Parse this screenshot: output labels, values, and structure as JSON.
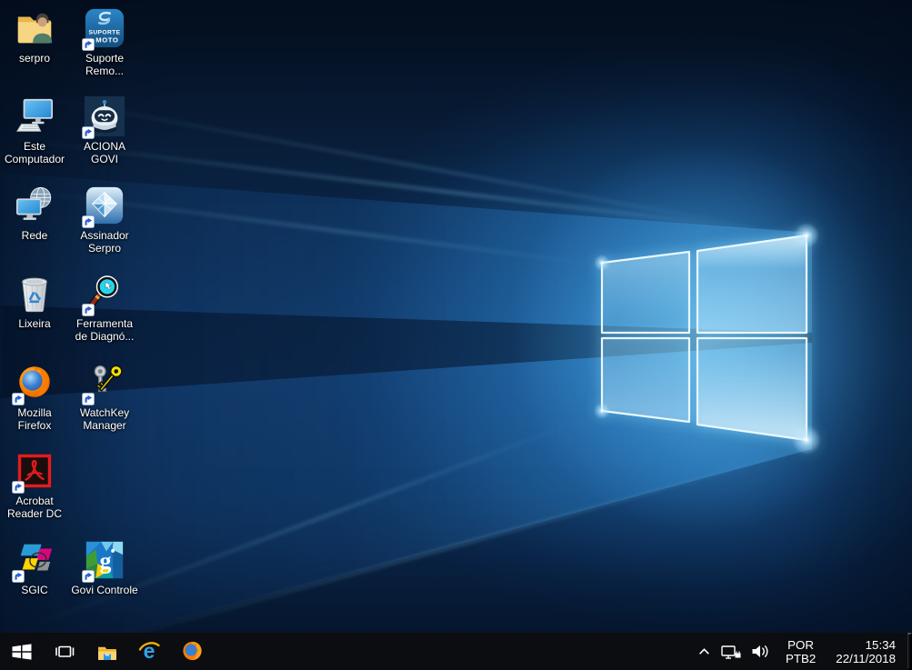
{
  "desktop": {
    "icons": [
      {
        "label": "serpro"
      },
      {
        "label": "Suporte Remo...",
        "icon_text": {
          "line1": "SUPORTE",
          "line2": "MOTO"
        }
      },
      {
        "label": "Este Computador"
      },
      {
        "label": "ACIONA GOVI"
      },
      {
        "label": "Rede"
      },
      {
        "label": "Assinador Serpro"
      },
      {
        "label": "Lixeira"
      },
      {
        "label": "Ferramenta de Diagnó..."
      },
      {
        "label": "Mozilla Firefox"
      },
      {
        "label": "WatchKey Manager"
      },
      {
        "label": "Acrobat Reader DC"
      },
      {
        "label": "SGIC"
      },
      {
        "label": "Govi Controle"
      }
    ]
  },
  "taskbar": {
    "icons": [
      "start",
      "task-view",
      "file-explorer",
      "internet-explorer",
      "firefox"
    ]
  },
  "tray": {
    "language": {
      "line1": "POR",
      "line2": "PTB2"
    },
    "clock": {
      "time": "15:34",
      "date": "22/11/2018"
    }
  },
  "colors": {
    "taskbar_bg": "#0c0d11",
    "wallpaper_base": "#0c2a52",
    "wallpaper_glow": "#3fa9f0",
    "shortcut_arrow_blue": "#2a5fd0",
    "label_text": "#ffffff"
  }
}
